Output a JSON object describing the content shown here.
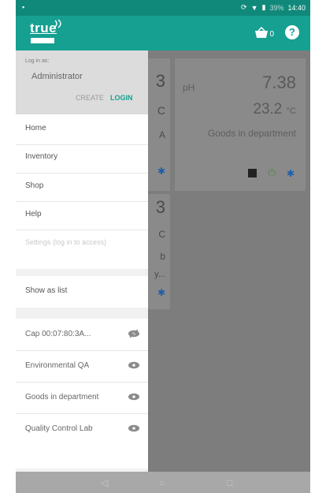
{
  "status_bar": {
    "time": "14:40",
    "battery": "39%"
  },
  "app_bar": {
    "logo_text": "true",
    "logo_subtext": "",
    "basket_count": "0",
    "help_label": "?"
  },
  "drawer": {
    "login": {
      "caption": "Log in as:",
      "user": "Administrator",
      "create_label": "CREATE",
      "login_label": "LOGIN"
    },
    "menu": [
      {
        "label": "Home",
        "enabled": true
      },
      {
        "label": "Inventory",
        "enabled": true
      },
      {
        "label": "Shop",
        "enabled": true
      },
      {
        "label": "Help",
        "enabled": true
      },
      {
        "label": "Settings (log in to access)",
        "enabled": false
      }
    ],
    "show_as_list_label": "Show as list",
    "devices": [
      {
        "name": "Cap 00:07:80:3A...",
        "visible": false
      },
      {
        "name": "Environmental QA",
        "visible": true
      },
      {
        "name": "Goods in department",
        "visible": true
      },
      {
        "name": "Quality Control Lab",
        "visible": true
      }
    ]
  },
  "background_cards": {
    "right": {
      "label": "pH",
      "value": "7.38",
      "temp_value": "23.2",
      "temp_unit": "°C",
      "location": "Goods in department"
    },
    "left_fragments": [
      "3",
      "C",
      "A",
      "3",
      "C",
      "b",
      "y..."
    ]
  },
  "colors": {
    "accent": "#16a091",
    "accent_dark": "#10897a"
  }
}
